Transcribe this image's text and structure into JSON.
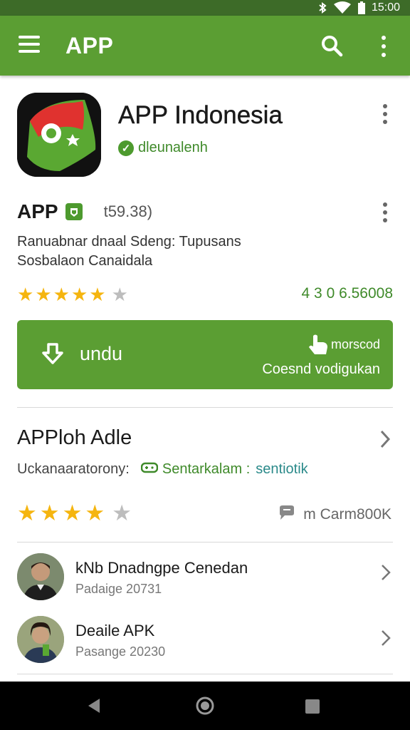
{
  "status_bar": {
    "time": "15:00"
  },
  "app_bar": {
    "title": "APP"
  },
  "app_header": {
    "name": "APP Indonesia",
    "developer": "dleunalenh"
  },
  "listing": {
    "label": "APP",
    "size": "t59.38)",
    "description_line1": "Ranuabnar dnaal Sdeng: Tupusans",
    "description_line2": "Sosbalaon Canaidala",
    "rating_stars": 4.5,
    "download_count": "4 3 0 6.56008"
  },
  "download_button": {
    "label": "undu",
    "right_top": "morscod",
    "right_bottom": "Coesnd vodigukan"
  },
  "section": {
    "title": "APPloh Adle",
    "subtitle": "Uckanaaratorony:",
    "category": "Sentarkalam :",
    "tag": "sentiotik",
    "rating_stars": 4.5,
    "reviews": "m Carm800K"
  },
  "developers": [
    {
      "name": "kNb Dnadngpe Cenedan",
      "sub": "Padaige 20731"
    },
    {
      "name": "Deaile APK",
      "sub": "Pasange 20230"
    }
  ],
  "colors": {
    "primary": "#5b9e33",
    "status": "#3d6b28",
    "star": "#f5b50f"
  }
}
